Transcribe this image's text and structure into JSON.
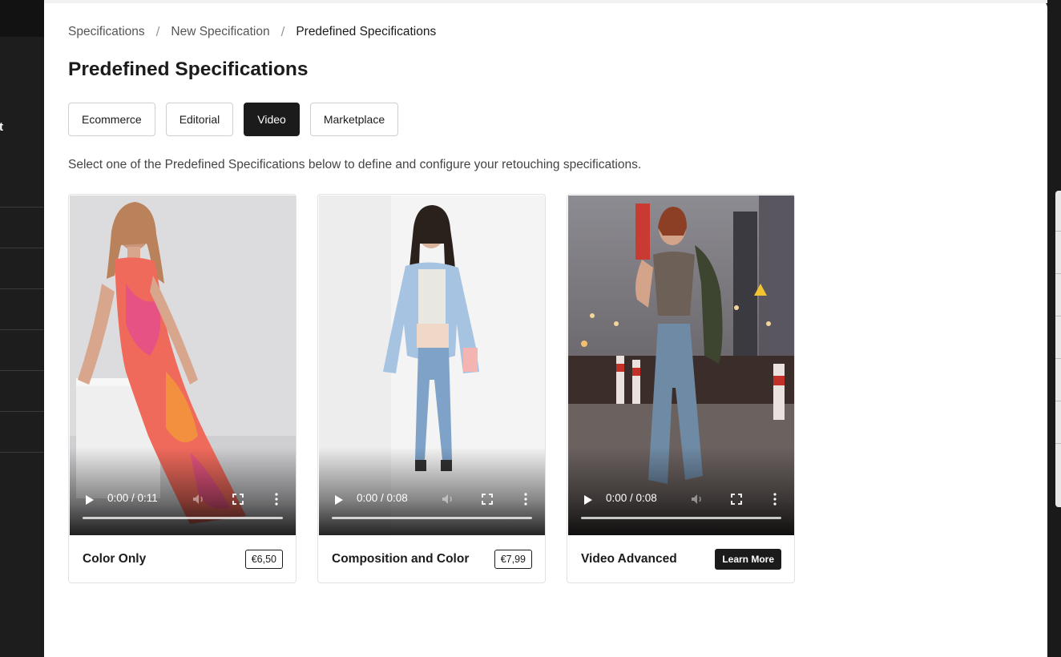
{
  "breadcrumb": {
    "items": [
      "Specifications",
      "New Specification",
      "Predefined Specifications"
    ],
    "separator": "/"
  },
  "page": {
    "title": "Predefined Specifications",
    "intro": "Select one of the Predefined Specifications below to define and configure your retouching specifications."
  },
  "tabs": [
    {
      "label": "Ecommerce",
      "active": false
    },
    {
      "label": "Editorial",
      "active": false
    },
    {
      "label": "Video",
      "active": true
    },
    {
      "label": "Marketplace",
      "active": false
    }
  ],
  "cards": [
    {
      "title": "Color Only",
      "time": "0:00 / 0:11",
      "price": "€6,50"
    },
    {
      "title": "Composition and Color",
      "time": "0:00 / 0:08",
      "price": "€7,99"
    },
    {
      "title": "Video Advanced",
      "time": "0:00 / 0:08",
      "action": "Learn More"
    }
  ],
  "sidebar": {
    "glyph": "t"
  },
  "colors": {
    "accent": "#1b1b1b",
    "sidebar": "#1d1d1d",
    "background": "#ffffff"
  }
}
